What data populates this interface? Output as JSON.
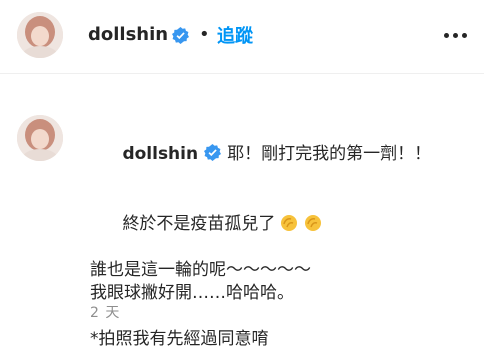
{
  "post_header": {
    "username": "dollshin",
    "separator": "•",
    "follow_label": "追蹤",
    "verified_icon": "verified-badge-icon",
    "more_icon": "more-options-icon"
  },
  "caption": {
    "username": "dollshin",
    "lines": [
      "耶！剛打完我的第一劑！！",
      "終於不是疫苗孤兒了",
      "誰也是這一輪的呢～～～～～",
      "我眼球撇好開……哈哈哈。",
      "",
      "*拍照我有先經過同意唷"
    ],
    "emoji": "clapping-hands-icon",
    "timestamp": "2 天"
  },
  "colors": {
    "accent": "#0095f6",
    "text": "#262626",
    "secondary": "#8e8e8e",
    "verified": "#3897f0"
  }
}
